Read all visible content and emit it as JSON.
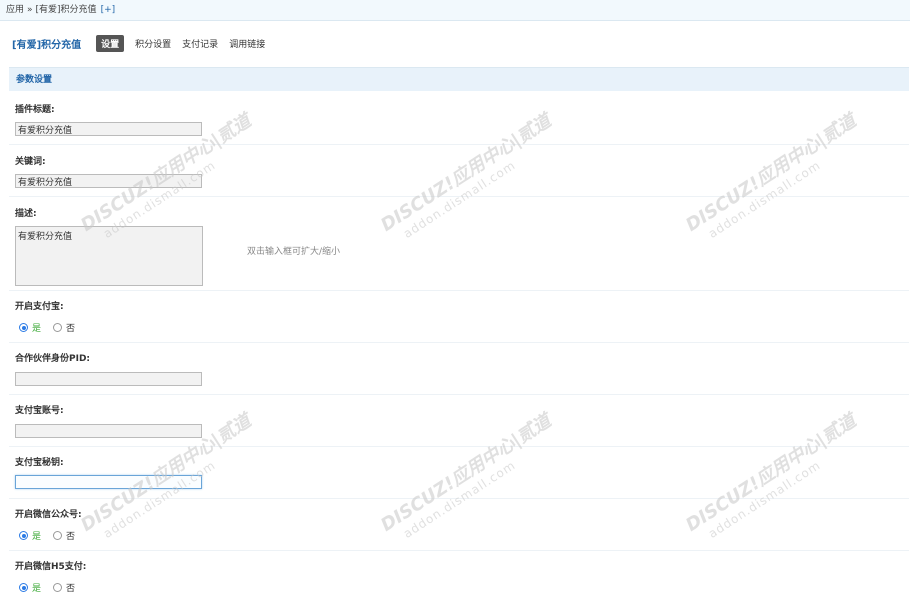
{
  "breadcrumb": {
    "root": "应用",
    "separator": "»",
    "current": "[有爱]积分充值",
    "add": "[+]"
  },
  "header": {
    "title": "[有爱]积分充值"
  },
  "tabs": [
    {
      "label": "设置",
      "active": true
    },
    {
      "label": "积分设置"
    },
    {
      "label": "支付记录"
    },
    {
      "label": "调用链接"
    }
  ],
  "section": {
    "title": "参数设置"
  },
  "fields": {
    "plugin_title": {
      "label": "插件标题:",
      "value": "有爱积分充值"
    },
    "keywords": {
      "label": "关键词:",
      "value": "有爱积分充值"
    },
    "description": {
      "label": "描述:",
      "value": "有爱积分充值",
      "hint": "双击输入框可扩大/缩小"
    },
    "alipay_enable": {
      "label": "开启支付宝:",
      "yes": "是",
      "no": "否"
    },
    "partner_pid": {
      "label": "合作伙伴身份PID:",
      "value": ""
    },
    "alipay_account": {
      "label": "支付宝账号:",
      "value": ""
    },
    "alipay_key": {
      "label": "支付宝秘钥:",
      "value": ""
    },
    "wechat_mp_enable": {
      "label": "开启微信公众号:",
      "yes": "是",
      "no": "否"
    },
    "wechat_h5_enable": {
      "label": "开启微信H5支付:",
      "yes": "是",
      "no": "否"
    }
  },
  "watermark": {
    "line1": "DISCUZ!应用中心|贰道",
    "line2": "addon.dismall.com"
  },
  "colors": {
    "accent": "#2366a8",
    "radio_on": "#2c7be5",
    "yes_text": "#3aa835",
    "section_bg": "#e8f2fa"
  }
}
